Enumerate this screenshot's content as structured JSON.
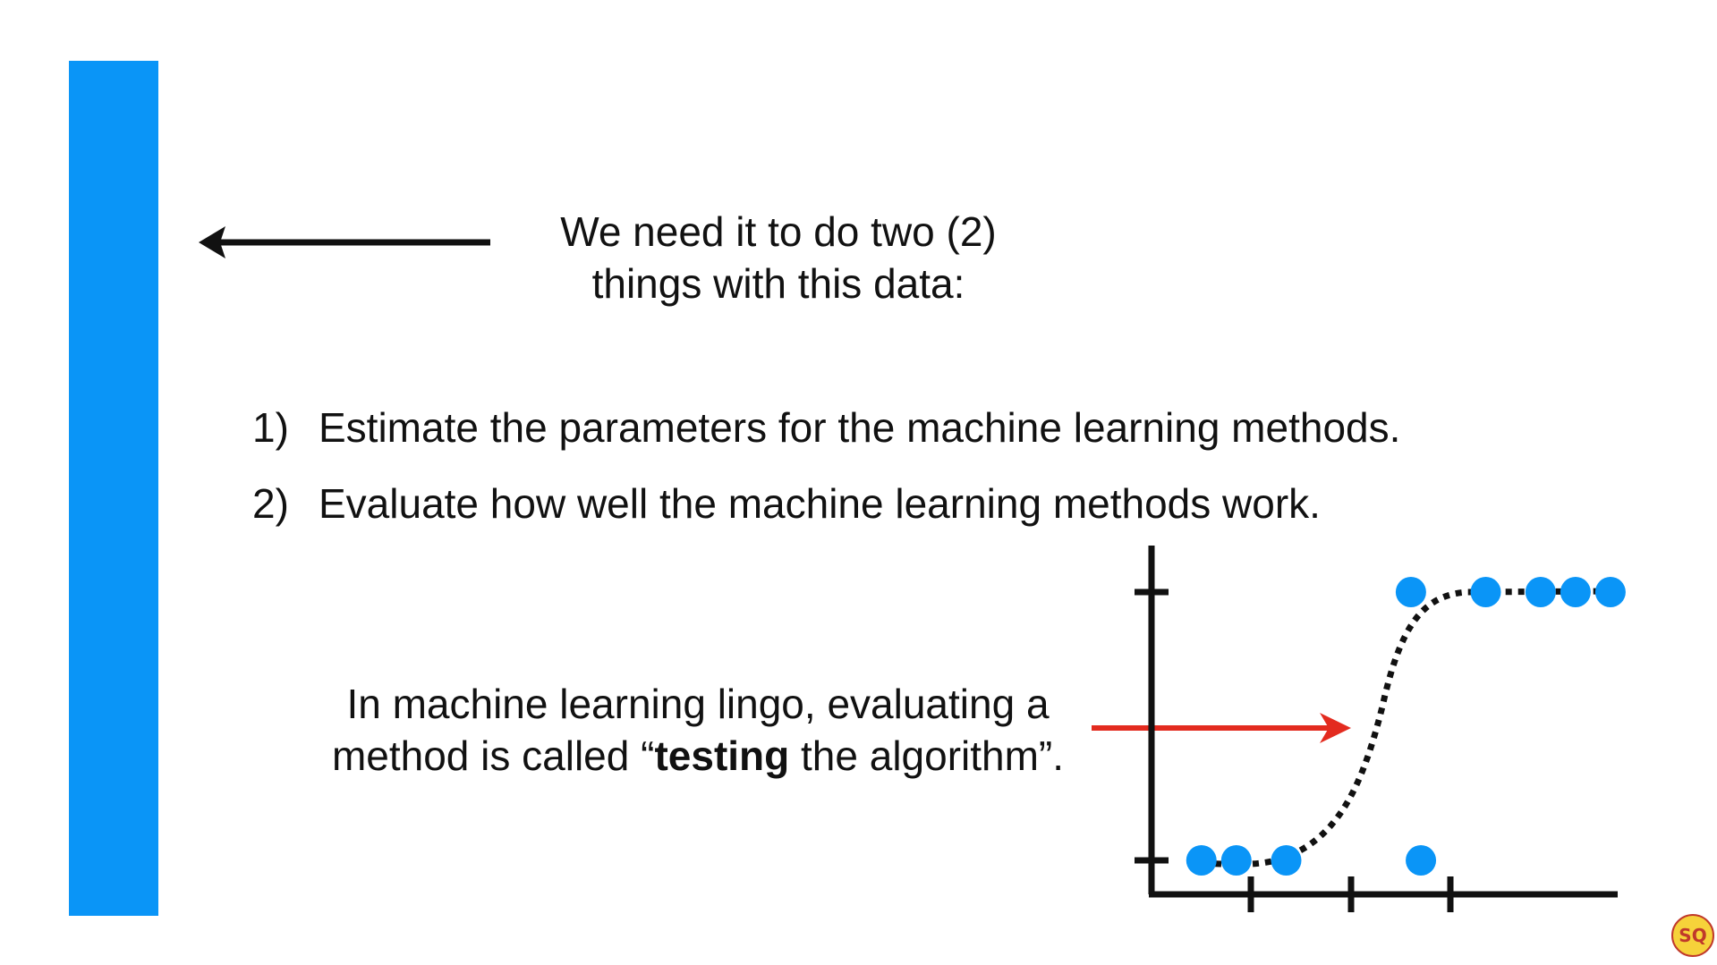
{
  "intro": {
    "line1": "We need it to do two (2)",
    "line2": "things with this data:"
  },
  "items": [
    {
      "num": "1)",
      "text": "Estimate the parameters for the machine learning methods."
    },
    {
      "num": "2)",
      "text": "Evaluate how well the machine learning methods work."
    }
  ],
  "lingo": {
    "line1": "In machine learning lingo, evaluating a",
    "line2_pre": "method is called “",
    "line2_bold": "testing",
    "line2_post": " the algorithm”."
  },
  "logo_text": "SQ",
  "colors": {
    "bar": "#0a95f7",
    "points": "#0a95f7",
    "red_arrow": "#e32b1f",
    "curve": "#111111"
  },
  "plot": {
    "points_top": [
      2.6,
      3.35,
      3.9,
      4.25,
      4.6
    ],
    "points_bottom": [
      0.5,
      0.85,
      1.35,
      2.7
    ],
    "y_levels": {
      "top": 1,
      "bottom": 0
    }
  }
}
